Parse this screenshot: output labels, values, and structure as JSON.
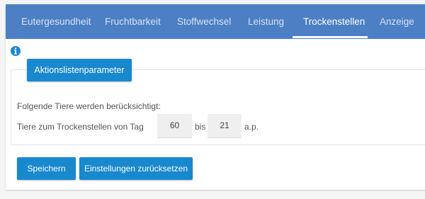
{
  "tabs": [
    {
      "label": "Eutergesundheit"
    },
    {
      "label": "Fruchtbarkeit"
    },
    {
      "label": "Stoffwechsel"
    },
    {
      "label": "Leistung"
    },
    {
      "label": "Trockenstellen",
      "active": true
    },
    {
      "label": "Anzeige"
    }
  ],
  "info": {
    "icon": "info-icon"
  },
  "section": {
    "legend": "Aktionslistenparameter",
    "intro": "Folgende Tiere werden berücksichtigt:",
    "range_label": "Tiere zum Trockenstellen von Tag",
    "from_value": "60",
    "between": "bis",
    "to_value": "21",
    "suffix": "a.p."
  },
  "actions": {
    "save": "Speichern",
    "reset": "Einstellungen zurücksetzen"
  },
  "colors": {
    "tabbar": "#4c7fc4",
    "accent": "#1888cf",
    "background": "#f5f5f5"
  }
}
